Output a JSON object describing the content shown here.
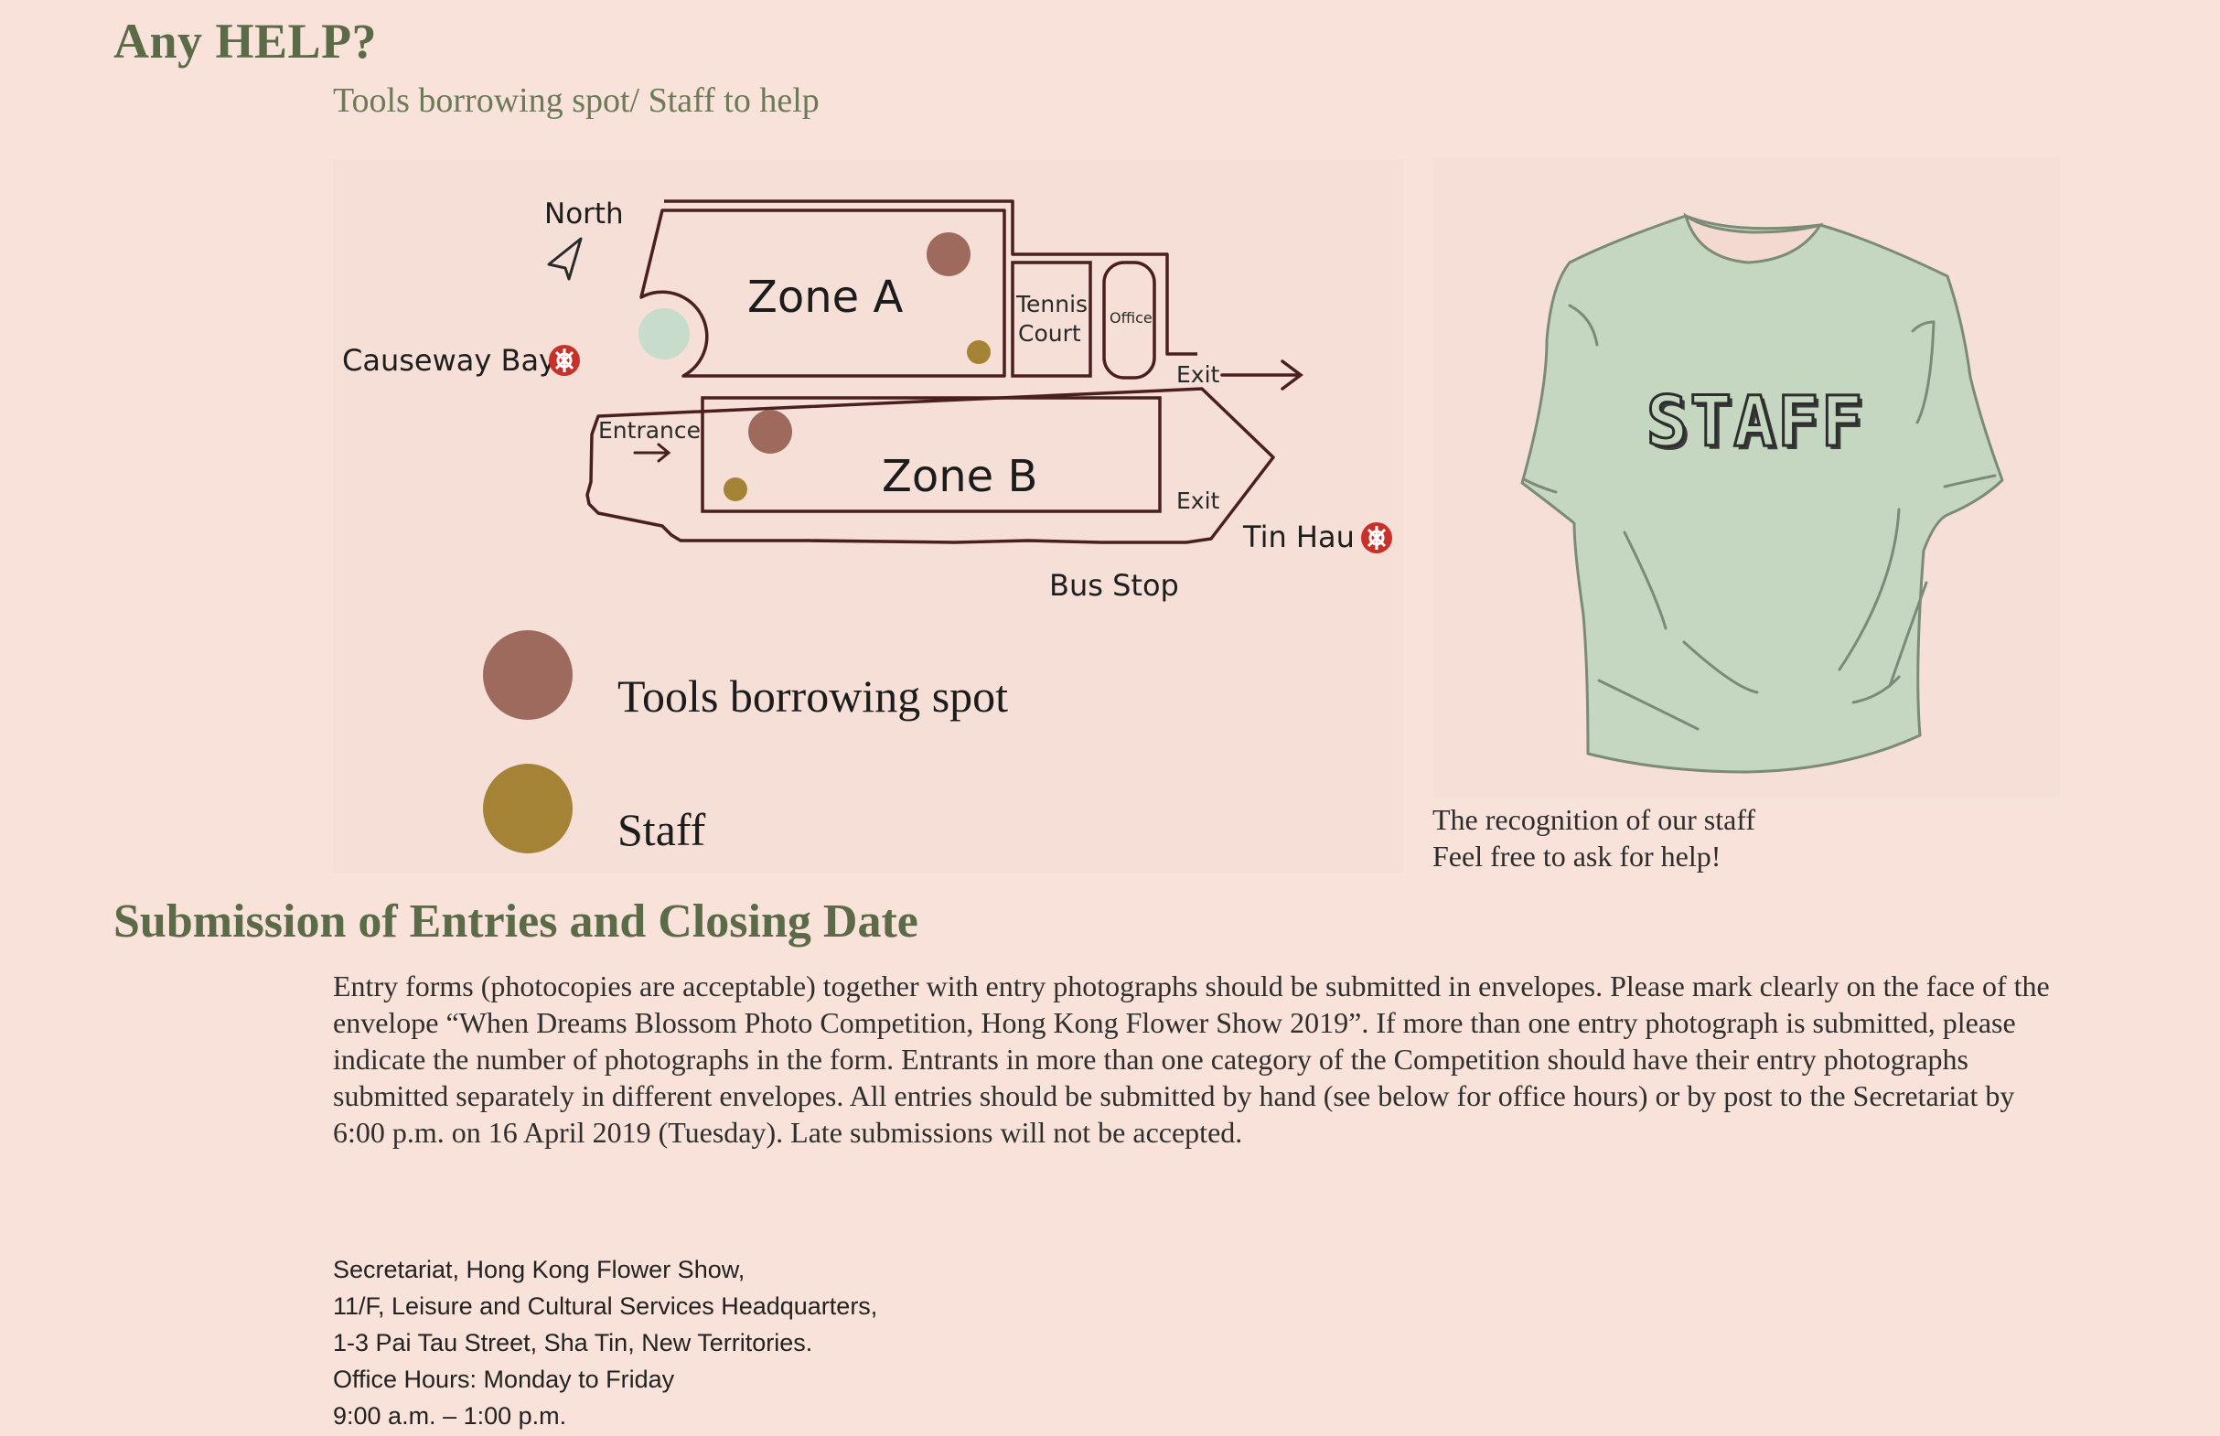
{
  "help": {
    "title": "Any HELP?",
    "subtitle": "Tools borrowing  spot/ Staff to help"
  },
  "map": {
    "north": "North",
    "zone_a": "Zone A",
    "zone_b": "Zone B",
    "tennis_line1": "Tennis",
    "tennis_line2": "Court",
    "office": "Office",
    "exit_top": "Exit",
    "exit_bottom": "Exit",
    "entrance": "Entrance",
    "causeway_bay": "Causeway Bay",
    "tin_hau": "Tin Hau",
    "bus_stop": "Bus Stop",
    "colors": {
      "tools": "#9e6a5d",
      "staff": "#a58336",
      "mint": "#c8dccb",
      "outline": "#4a1f1f",
      "mtr": "#c8312a"
    }
  },
  "legend": {
    "tools_label": "Tools borrowing spot",
    "staff_label": "Staff"
  },
  "shirt": {
    "text": "STAFF",
    "caption_line1": "The recognition of our staff",
    "caption_line2": "Feel free to ask for help!",
    "color": "#c5d6c1"
  },
  "submission": {
    "title": "Submission of Entries and Closing Date",
    "paragraph": "Entry forms (photocopies are acceptable) together with entry photographs should be submitted in envelopes. Please mark clearly on the face of the envelope “When Dreams Blossom Photo Competition, Hong Kong Flower Show 2019”. If more than one entry photograph is submitted, please indicate the number of photographs in the form. Entrants in more than one category of the Competition should have their entry photographs submitted separately in different envelopes. All entries should be submitted by hand (see below for office hours) or by post to the Secretariat by 6:00 p.m. on 16 April 2019 (Tuesday). Late submissions will not be accepted.",
    "address": [
      "Secretariat, Hong Kong Flower Show,",
      "11/F, Leisure and Cultural Services Headquarters,",
      "1-3 Pai Tau Street, Sha Tin, New Territories.",
      "Office Hours: Monday to Friday",
      "9:00 a.m. – 1:00 p.m."
    ]
  }
}
